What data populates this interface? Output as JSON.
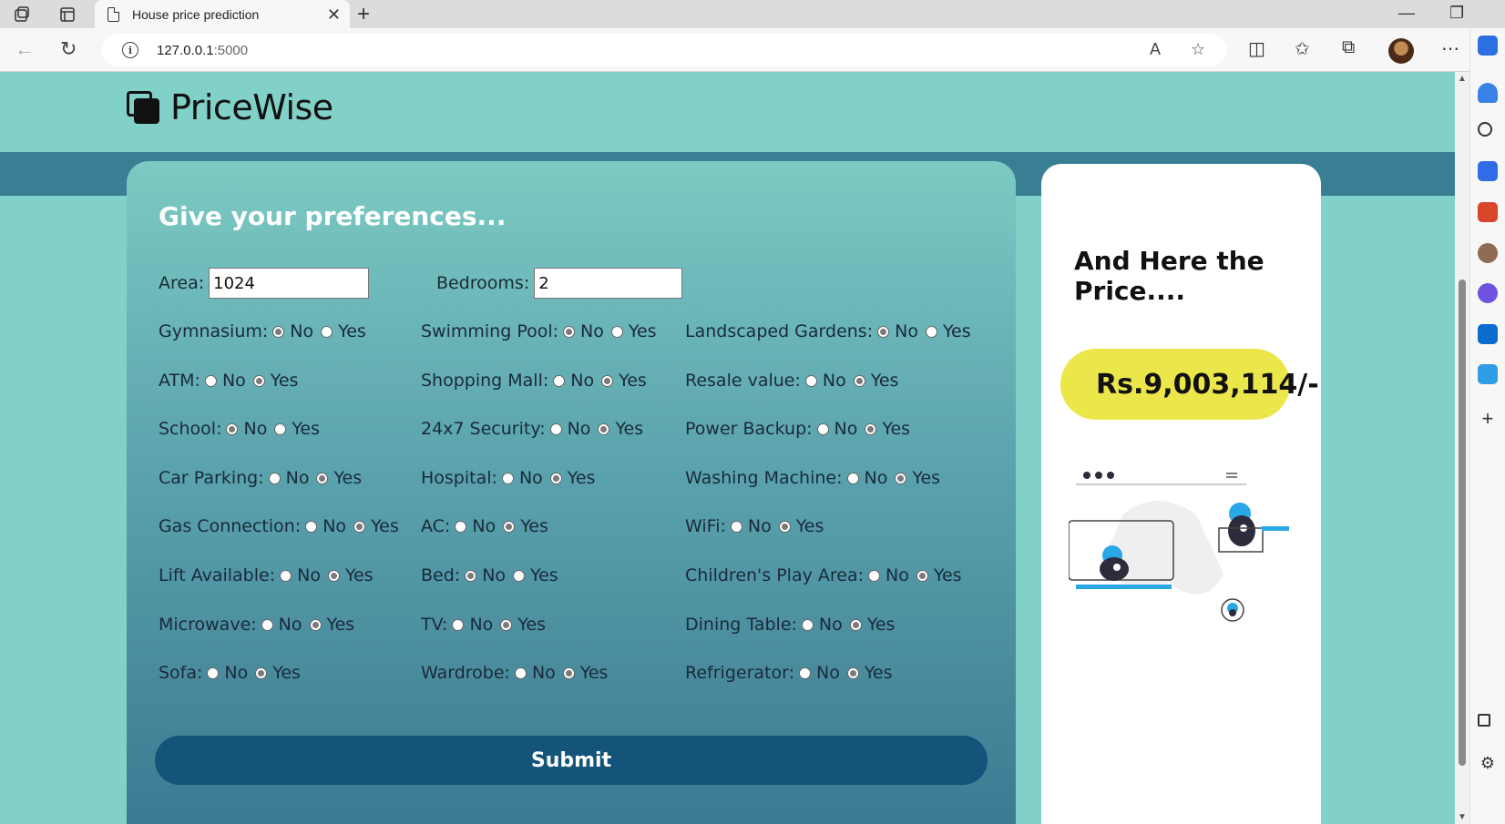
{
  "browser": {
    "tab_title": "House price prediction",
    "url_host": "127.0.0.1",
    "url_port": ":5000"
  },
  "brand": {
    "name": "PriceWise"
  },
  "form": {
    "title": "Give your preferences...",
    "area": {
      "label": "Area:",
      "value": "1024"
    },
    "bedrooms": {
      "label": "Bedrooms:",
      "value": "2"
    },
    "no_label": "No",
    "yes_label": "Yes",
    "amenities": [
      {
        "label": "Gymnasium:",
        "selected": "No"
      },
      {
        "label": "Swimming Pool:",
        "selected": "No"
      },
      {
        "label": "Landscaped Gardens:",
        "selected": "No"
      },
      {
        "label": "ATM:",
        "selected": "Yes"
      },
      {
        "label": "Shopping Mall:",
        "selected": "Yes"
      },
      {
        "label": "Resale value:",
        "selected": "Yes"
      },
      {
        "label": "School:",
        "selected": "No"
      },
      {
        "label": "24x7 Security:",
        "selected": "Yes"
      },
      {
        "label": "Power Backup:",
        "selected": "Yes"
      },
      {
        "label": "Car Parking:",
        "selected": "Yes"
      },
      {
        "label": "Hospital:",
        "selected": "Yes"
      },
      {
        "label": "Washing Machine:",
        "selected": "Yes"
      },
      {
        "label": "Gas Connection:",
        "selected": "Yes"
      },
      {
        "label": "AC:",
        "selected": "Yes"
      },
      {
        "label": "WiFi:",
        "selected": "Yes"
      },
      {
        "label": "Lift Available:",
        "selected": "Yes"
      },
      {
        "label": "Bed:",
        "selected": "No"
      },
      {
        "label": "Children's Play Area:",
        "selected": "Yes"
      },
      {
        "label": "Microwave:",
        "selected": "Yes"
      },
      {
        "label": "TV:",
        "selected": "Yes"
      },
      {
        "label": "Dining Table:",
        "selected": "Yes"
      },
      {
        "label": "Sofa:",
        "selected": "Yes"
      },
      {
        "label": "Wardrobe:",
        "selected": "Yes"
      },
      {
        "label": "Refrigerator:",
        "selected": "Yes"
      }
    ],
    "submit_label": "Submit"
  },
  "result": {
    "title": "And Here the Price....",
    "price": "Rs.9,003,114/-"
  },
  "colors": {
    "page_bg": "#82d1c8",
    "band": "#3a7e94",
    "submit_bg": "#14537a",
    "price_pill": "#ebe64a",
    "illustration_accent": "#29a8e8"
  }
}
